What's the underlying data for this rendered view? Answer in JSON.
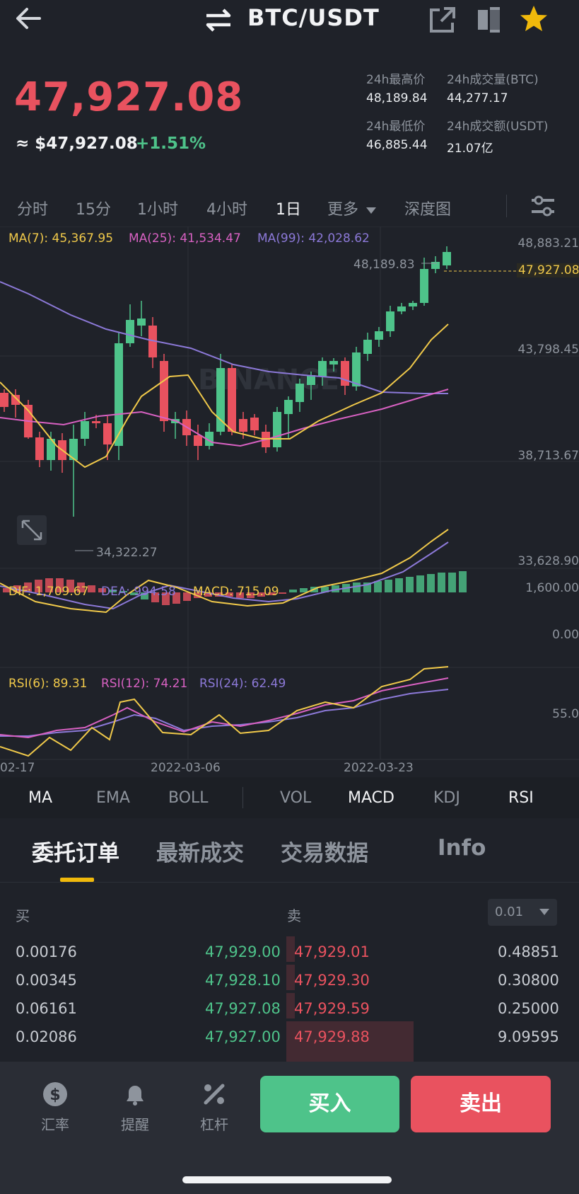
{
  "header": {
    "pair": "BTC/USDT",
    "icons": [
      "back-arrow-icon",
      "swap-icon",
      "share-icon",
      "book-icon",
      "star-icon"
    ]
  },
  "ticker": {
    "price": "47,927.08",
    "usd_price": "≈ $47,927.08",
    "change": "+1.51%",
    "high_label": "24h最高价",
    "high_value": "48,189.84",
    "vol_btc_label": "24h成交量(BTC)",
    "vol_btc_value": "44,277.17",
    "low_label": "24h最低价",
    "low_value": "46,885.44",
    "vol_usdt_label": "24h成交额(USDT)",
    "vol_usdt_value": "21.07亿"
  },
  "timeframes": [
    "分时",
    "15分",
    "1小时",
    "4小时",
    "1日",
    "更多",
    "深度图"
  ],
  "active_timeframe": "1日",
  "chart": {
    "ma7": "MA(7): 45,367.95",
    "ma25": "MA(25): 41,534.47",
    "ma99": "MA(99): 42,028.62",
    "y_ticks": [
      "48,883.21",
      "43,798.45",
      "38,713.67",
      "33,628.90"
    ],
    "high_marker": "48,189.83",
    "low_marker": "34,322.27",
    "last_price_tag": "47,927.08",
    "watermark": "BINANCE",
    "macd_dif": "DIF: 1,709.67",
    "macd_dea": "DEA: 994.58",
    "macd_val": "MACD: 715.09",
    "macd_ticks": [
      "1,600.00",
      "0.00"
    ],
    "rsi6": "RSI(6): 89.31",
    "rsi12": "RSI(12): 74.21",
    "rsi24": "RSI(24): 62.49",
    "rsi_tick": "55.0",
    "x_dates": [
      "02-17",
      "2022-03-06",
      "2022-03-23"
    ],
    "colors": {
      "up": "#4ec38a",
      "down": "#e9525f",
      "ma7": "#f0c94a",
      "ma25": "#d861c2",
      "ma99": "#8c79d8"
    }
  },
  "indicators": [
    "MA",
    "EMA",
    "BOLL",
    "VOL",
    "MACD",
    "KDJ",
    "RSI"
  ],
  "active_indicators": [
    "MA",
    "MACD",
    "RSI"
  ],
  "sections": [
    "委托订单",
    "最新成交",
    "交易数据",
    "Info"
  ],
  "active_section": "委托订单",
  "orderbook": {
    "buy_label": "买",
    "sell_label": "卖",
    "precision": "0.01",
    "rows": [
      {
        "bid_qty": "0.00176",
        "bid_price": "47,929.00",
        "ask_price": "47,929.01",
        "ask_qty": "0.48851"
      },
      {
        "bid_qty": "0.00345",
        "bid_price": "47,928.10",
        "ask_price": "47,929.30",
        "ask_qty": "0.30800"
      },
      {
        "bid_qty": "0.06161",
        "bid_price": "47,927.08",
        "ask_price": "47,929.59",
        "ask_qty": "0.25000"
      },
      {
        "bid_qty": "0.02086",
        "bid_price": "47,927.00",
        "ask_price": "47,929.88",
        "ask_qty": "9.09595"
      }
    ]
  },
  "bottom_bar": {
    "rate_label": "汇率",
    "alert_label": "提醒",
    "leverage_label": "杠杆",
    "buy_label": "买入",
    "sell_label": "卖出"
  }
}
